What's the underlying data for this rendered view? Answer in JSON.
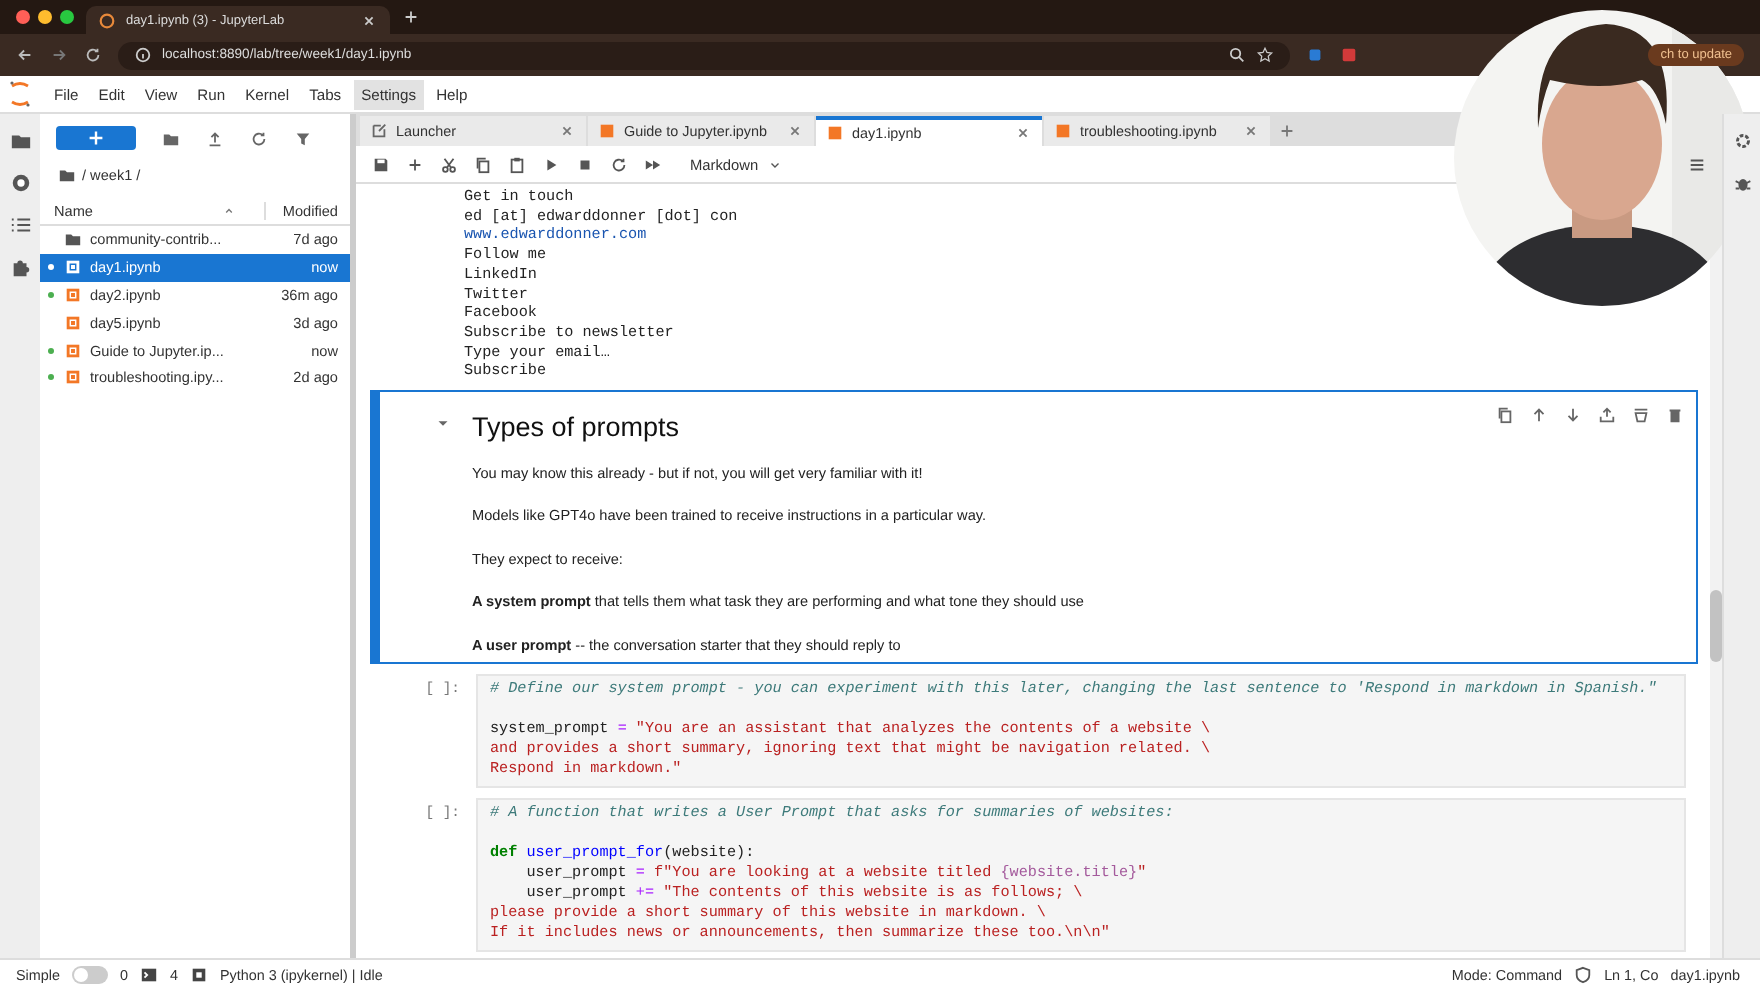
{
  "browser": {
    "tab_title": "day1.ipynb (3) - JupyterLab",
    "url": "localhost:8890/lab/tree/week1/day1.ipynb",
    "update_text": "ch to update"
  },
  "menu": [
    {
      "label": "File",
      "selected": false
    },
    {
      "label": "Edit",
      "selected": false
    },
    {
      "label": "View",
      "selected": false
    },
    {
      "label": "Run",
      "selected": false
    },
    {
      "label": "Kernel",
      "selected": false
    },
    {
      "label": "Tabs",
      "selected": false
    },
    {
      "label": "Settings",
      "selected": true
    },
    {
      "label": "Help",
      "selected": false
    }
  ],
  "file_browser": {
    "breadcrumb": "/ week1 /",
    "columns": [
      "Name",
      "Modified"
    ],
    "files": [
      {
        "name": "community-contrib...",
        "modified": "7d ago",
        "kind": "folder",
        "running": false,
        "selected": false
      },
      {
        "name": "day1.ipynb",
        "modified": "now",
        "kind": "notebook",
        "running": true,
        "selected": true
      },
      {
        "name": "day2.ipynb",
        "modified": "36m ago",
        "kind": "notebook",
        "running": true,
        "selected": false
      },
      {
        "name": "day5.ipynb",
        "modified": "3d ago",
        "kind": "notebook",
        "running": false,
        "selected": false
      },
      {
        "name": "Guide to Jupyter.ip...",
        "modified": "now",
        "kind": "notebook",
        "running": true,
        "selected": false
      },
      {
        "name": "troubleshooting.ipy...",
        "modified": "2d ago",
        "kind": "notebook",
        "running": true,
        "selected": false
      }
    ]
  },
  "tabs": [
    {
      "label": "Launcher",
      "kind": "launcher",
      "selected": false
    },
    {
      "label": "Guide to Jupyter.ipynb",
      "kind": "notebook",
      "selected": false
    },
    {
      "label": "day1.ipynb",
      "kind": "notebook",
      "selected": true
    },
    {
      "label": "troubleshooting.ipynb",
      "kind": "notebook",
      "selected": false
    }
  ],
  "toolbar": {
    "cell_type": "Markdown"
  },
  "output_lines": [
    {
      "text": "Get in touch",
      "kind": "text"
    },
    {
      "text": "ed [at] edwarddonner [dot] con",
      "kind": "text"
    },
    {
      "text": "www.edwarddonner.com",
      "kind": "link"
    },
    {
      "text": "Follow me",
      "kind": "text"
    },
    {
      "text": "LinkedIn",
      "kind": "text"
    },
    {
      "text": "Twitter",
      "kind": "text"
    },
    {
      "text": "Facebook",
      "kind": "text"
    },
    {
      "text": "Subscribe to newsletter",
      "kind": "text"
    },
    {
      "text": "Type your email…",
      "kind": "text"
    },
    {
      "text": "Subscribe",
      "kind": "text"
    }
  ],
  "markdown_cell": {
    "heading": "Types of prompts",
    "paragraphs": [
      "You may know this already - but if not, you will get very familiar with it!",
      "Models like GPT4o have been trained to receive instructions in a particular way.",
      "They expect to receive:",
      "**A system prompt** that tells them what task they are performing and what tone they should use",
      "**A user prompt** -- the conversation starter that they should reply to"
    ]
  },
  "code_cells": [
    {
      "prompt": "[ ]:",
      "blocks": [
        [
          [
            {
              "kind": "comment",
              "text": "# Define our system prompt - you can experiment with this later, changing the last sentence to 'Respond in markdown in Spanish.\""
            }
          ]
        ],
        [
          [
            {
              "kind": "plain",
              "text": "system_prompt "
            },
            {
              "kind": "operator",
              "text": "="
            },
            {
              "kind": "string",
              "text": " \"You are an assistant that analyzes the contents of a website \\"
            }
          ],
          [
            {
              "kind": "string",
              "text": "and provides a short summary, ignoring text that might be navigation related. \\"
            }
          ],
          [
            {
              "kind": "string",
              "text": "Respond in markdown.\""
            }
          ]
        ]
      ]
    },
    {
      "prompt": "[ ]:",
      "blocks": [
        [
          [
            {
              "kind": "comment",
              "text": "# A function that writes a User Prompt that asks for summaries of websites:"
            }
          ]
        ],
        [
          [
            {
              "kind": "keyword",
              "text": "def "
            },
            {
              "kind": "function",
              "text": "user_prompt_for"
            },
            {
              "kind": "plain",
              "text": "(website):"
            }
          ],
          [
            {
              "kind": "plain",
              "text": "    user_prompt "
            },
            {
              "kind": "operator",
              "text": "="
            },
            {
              "kind": "string",
              "text": " f\"You are looking at a website titled "
            },
            {
              "kind": "interp",
              "text": "{website.title}"
            },
            {
              "kind": "string",
              "text": "\""
            }
          ],
          [
            {
              "kind": "plain",
              "text": "    user_prompt "
            },
            {
              "kind": "operator",
              "text": "+="
            },
            {
              "kind": "string",
              "text": " \"The contents of this website is as follows; \\"
            }
          ],
          [
            {
              "kind": "string",
              "text": "please provide a short summary of this website in markdown. \\"
            }
          ],
          [
            {
              "kind": "string",
              "text": "If it includes news or announcements, then summarize these too.\\n\\n\""
            }
          ]
        ]
      ]
    }
  ],
  "status_bar": {
    "mode_label": "Simple",
    "simple_on": false,
    "terminals": "0",
    "kernels": "4",
    "kernel": "Python 3 (ipykernel) | Idle",
    "mode": "Mode: Command",
    "position": "Ln 1, Co",
    "file": "day1.ipynb"
  }
}
